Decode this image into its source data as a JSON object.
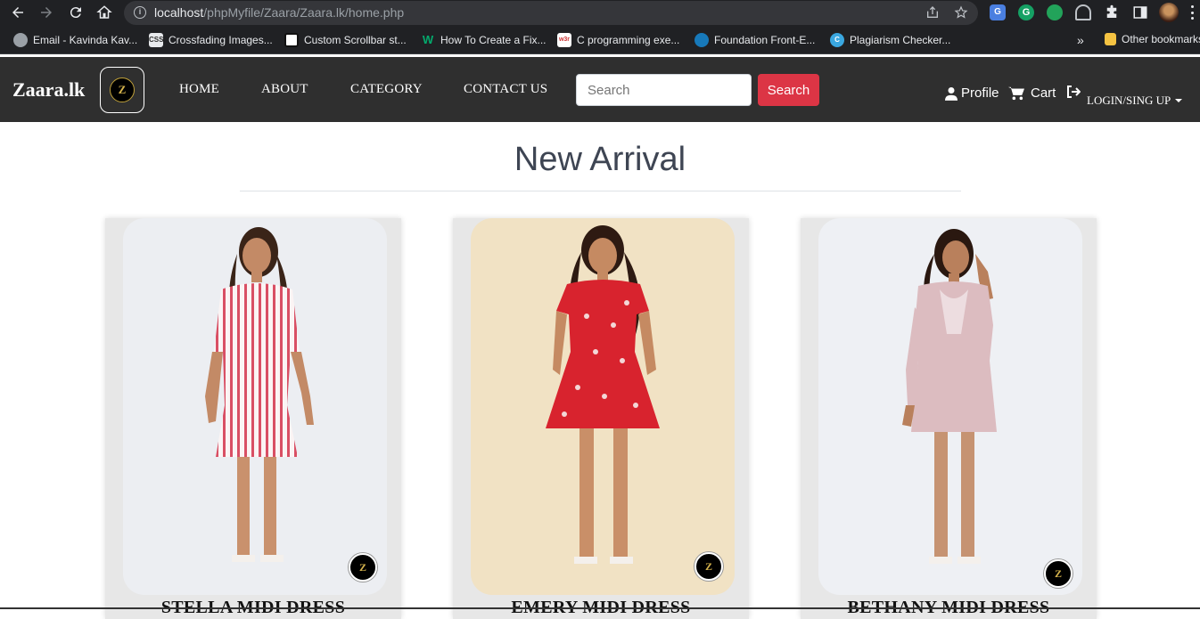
{
  "browser": {
    "url_host": "localhost",
    "url_path": "/phpMyfile/Zaara/Zaara.lk/home.php",
    "bookmarks": [
      {
        "label": "Email - Kavinda Kav...",
        "icon": "globe-icon"
      },
      {
        "label": "Crossfading Images...",
        "icon": "css3-icon"
      },
      {
        "label": "Custom Scrollbar st...",
        "icon": "codepen-icon"
      },
      {
        "label": "How To Create a Fix...",
        "icon": "w-icon"
      },
      {
        "label": "C programming exe...",
        "icon": "w3r-icon"
      },
      {
        "label": "Foundation Front-E...",
        "icon": "foundation-icon"
      },
      {
        "label": "Plagiarism Checker...",
        "icon": "c-icon"
      }
    ],
    "more_bookmarks": "»",
    "other_bookmarks": "Other bookmarks"
  },
  "navbar": {
    "brand": "Zaara.lk",
    "logo_letter": "Z",
    "links": [
      "HOME",
      "ABOUT",
      "CATEGORY",
      "CONTACT US"
    ],
    "search_placeholder": "Search",
    "search_button": "Search",
    "profile": "Profile",
    "cart": "Cart",
    "login": "LOGIN/SING UP"
  },
  "main": {
    "title": "New Arrival",
    "products": [
      {
        "name": "STELLA MIDI DRESS",
        "bg": "#eceef2",
        "dress": "striped"
      },
      {
        "name": "EMERY MIDI DRESS",
        "bg": "#f1e2c4",
        "dress": "#d8232e"
      },
      {
        "name": "BETHANY MIDI DRESS",
        "bg": "#eef0f4",
        "dress": "#dcbcc0"
      }
    ]
  },
  "colors": {
    "navbar_bg": "#2f2f2f",
    "search_button": "#dc3545",
    "title_text": "#3e4553"
  }
}
